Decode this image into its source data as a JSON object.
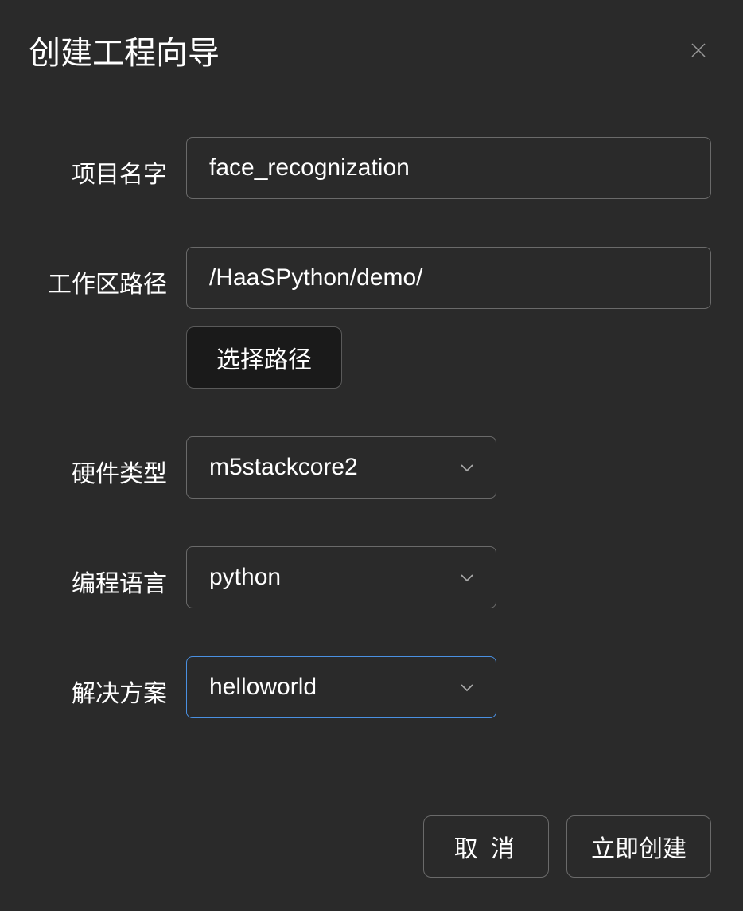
{
  "dialog": {
    "title": "创建工程向导"
  },
  "form": {
    "projectName": {
      "label": "项目名字",
      "value": "face_recognization"
    },
    "workspacePath": {
      "label": "工作区路径",
      "value": "/HaaSPython/demo/",
      "selectButton": "选择路径"
    },
    "hardwareType": {
      "label": "硬件类型",
      "value": "m5stackcore2"
    },
    "language": {
      "label": "编程语言",
      "value": "python"
    },
    "solution": {
      "label": "解决方案",
      "value": "helloworld"
    }
  },
  "footer": {
    "cancel": "取 消",
    "create": "立即创建"
  }
}
